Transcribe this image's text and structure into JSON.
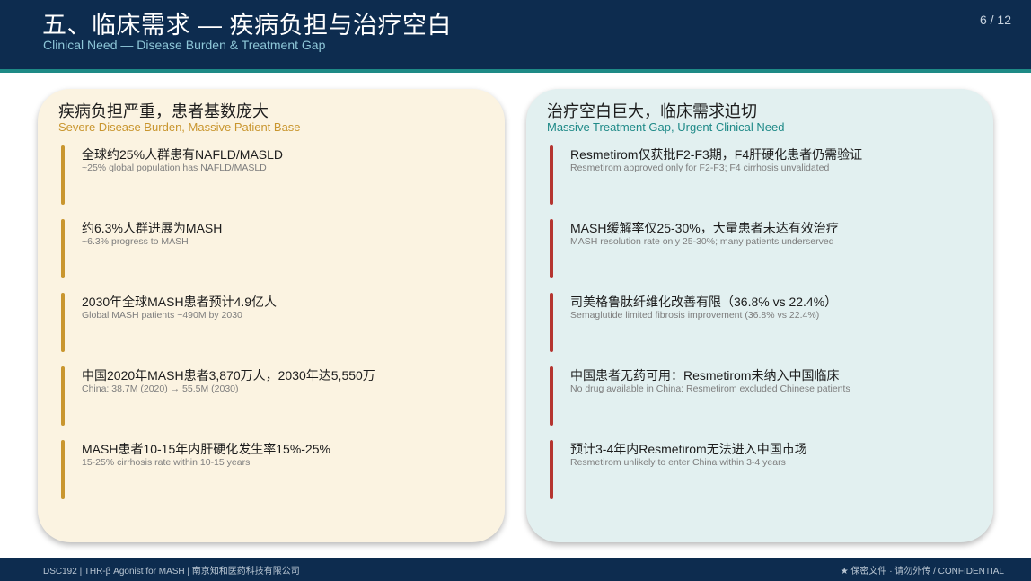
{
  "header": {
    "title": "五、临床需求 — 疾病负担与治疗空白",
    "subtitle": "Clinical Need — Disease Burden & Treatment Gap",
    "page_number": "6 / 12"
  },
  "left_panel": {
    "title": "疾病负担严重，患者基数庞大",
    "subtitle": "Severe Disease Burden, Massive Patient Base",
    "items": [
      {
        "title": "全球约25%人群患有NAFLD/MASLD",
        "subtitle": "~25% global population has NAFLD/MASLD"
      },
      {
        "title": "约6.3%人群进展为MASH",
        "subtitle": "~6.3% progress to MASH"
      },
      {
        "title": "2030年全球MASH患者预计4.9亿人",
        "subtitle": "Global MASH patients ~490M by 2030"
      },
      {
        "title": "中国2020年MASH患者3,870万人，2030年达5,550万",
        "subtitle": "China: 38.7M (2020) → 55.5M (2030)"
      },
      {
        "title": "MASH患者10-15年内肝硬化发生率15%-25%",
        "subtitle": "15-25% cirrhosis rate within 10-15 years"
      }
    ]
  },
  "right_panel": {
    "title": "治疗空白巨大，临床需求迫切",
    "subtitle": "Massive Treatment Gap, Urgent Clinical Need",
    "items": [
      {
        "title": "Resmetirom仅获批F2-F3期，F4肝硬化患者仍需验证",
        "subtitle": "Resmetirom approved only for F2-F3; F4 cirrhosis unvalidated"
      },
      {
        "title": "MASH缓解率仅25-30%，大量患者未达有效治疗",
        "subtitle": "MASH resolution rate only 25-30%; many patients underserved"
      },
      {
        "title": "司美格鲁肽纤维化改善有限（36.8% vs 22.4%）",
        "subtitle": "Semaglutide limited fibrosis improvement (36.8% vs 22.4%)"
      },
      {
        "title": "中国患者无药可用：Resmetirom未纳入中国临床",
        "subtitle": "No drug available in China: Resmetirom excluded Chinese patients"
      },
      {
        "title": "预计3-4年内Resmetirom无法进入中国市场",
        "subtitle": "Resmetirom unlikely to enter China within 3-4 years"
      }
    ]
  },
  "footer": {
    "left": "DSC192 | THR-β Agonist for MASH | 南京知和医药科技有限公司",
    "right": "★ 保密文件 · 请勿外传 / CONFIDENTIAL"
  },
  "colors": {
    "header_bg": "#0d2c4f",
    "accent_teal": "#1e8a86",
    "left_panel_bg": "#fbf3e1",
    "left_accent": "#c9962f",
    "right_panel_bg": "#e2f0f0",
    "right_accent": "#b53530"
  }
}
